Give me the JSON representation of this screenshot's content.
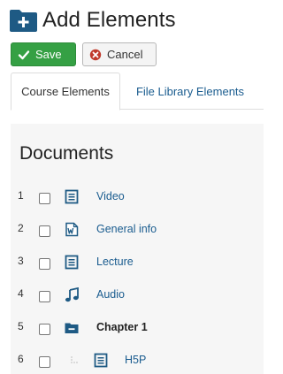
{
  "header": {
    "title": "Add Elements",
    "icon": "folder-plus-icon",
    "icon_color": "#1e5a84"
  },
  "toolbar": {
    "save_label": "Save",
    "cancel_label": "Cancel",
    "save_color": "#35a044",
    "cancel_icon_color": "#c0392b"
  },
  "tabs": [
    {
      "label": "Course Elements",
      "active": true
    },
    {
      "label": "File Library Elements",
      "active": false
    }
  ],
  "panel": {
    "heading": "Documents"
  },
  "rows": [
    {
      "num": "1",
      "label": "Video",
      "icon": "document-icon",
      "bold": false
    },
    {
      "num": "2",
      "label": "General info",
      "icon": "word-document-icon",
      "bold": false
    },
    {
      "num": "3",
      "label": "Lecture",
      "icon": "document-icon",
      "bold": false
    },
    {
      "num": "4",
      "label": "Audio",
      "icon": "music-note-icon",
      "bold": false
    },
    {
      "num": "5",
      "label": "Chapter 1",
      "icon": "folder-collapse-icon",
      "bold": true
    },
    {
      "num": "6",
      "label": "H5P",
      "icon": "document-icon",
      "bold": false,
      "indent": true
    }
  ],
  "colors": {
    "link": "#1a5c8f",
    "icon": "#1e5a84",
    "stripe": "#f6f6f6"
  }
}
